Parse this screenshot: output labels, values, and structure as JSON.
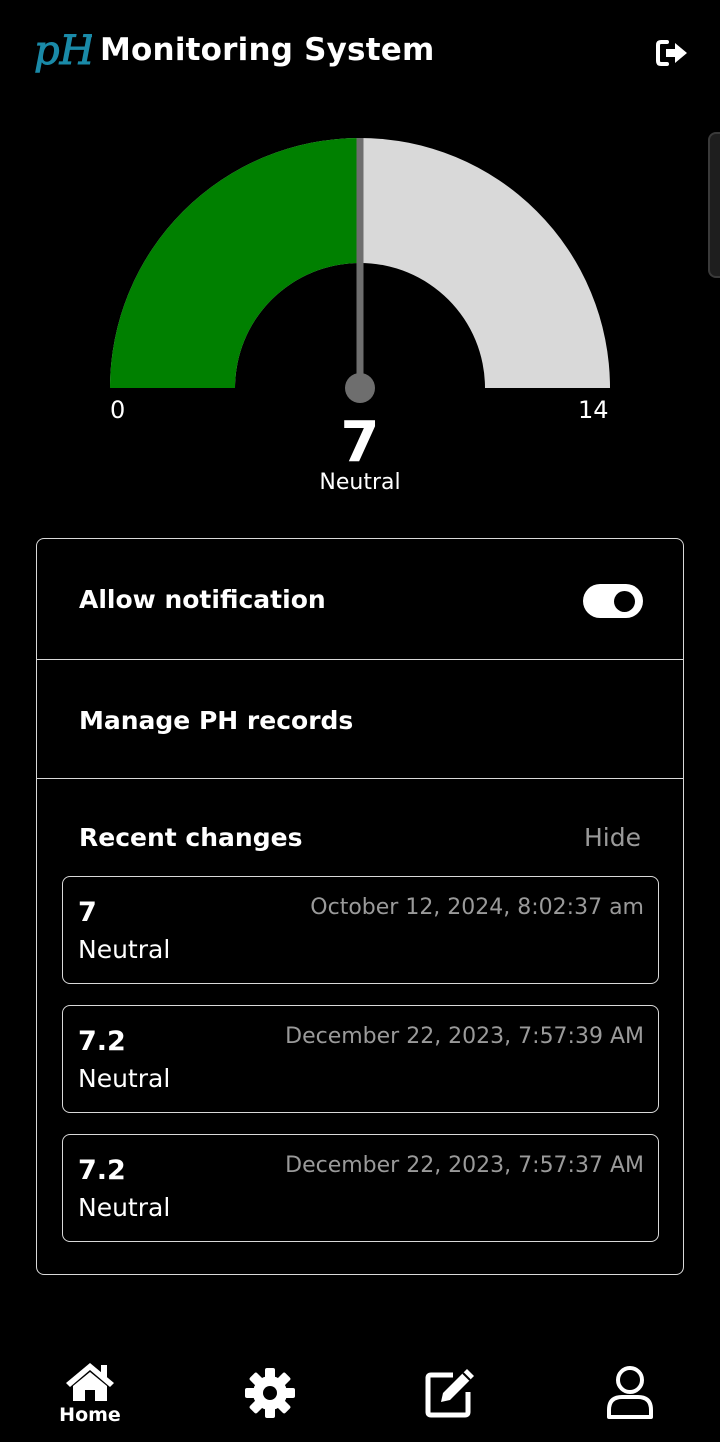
{
  "header": {
    "logo_text": "pH",
    "title": "Monitoring System",
    "logout_icon": "logout-icon"
  },
  "gauge": {
    "min_label": "0",
    "max_label": "14",
    "min": 0,
    "max": 14,
    "value": 7,
    "value_label": "7",
    "status": "Neutral",
    "fill_color": "#008000",
    "track_color": "#d9d9d9",
    "needle_color": "#6e6e6e"
  },
  "settings": {
    "notification_label": "Allow notification",
    "notification_enabled": true,
    "manage_label": "Manage PH records"
  },
  "recent": {
    "title": "Recent changes",
    "hide_label": "Hide",
    "records": [
      {
        "value": "7",
        "status": "Neutral",
        "time": "October 12, 2024, 8:02:37 am"
      },
      {
        "value": "7.2",
        "status": "Neutral",
        "time": "December 22, 2023, 7:57:39 AM"
      },
      {
        "value": "7.2",
        "status": "Neutral",
        "time": "December 22, 2023, 7:57:37 AM"
      }
    ]
  },
  "nav": {
    "items": [
      {
        "icon": "home-icon",
        "label": "Home",
        "active": true
      },
      {
        "icon": "gear-icon",
        "label": "",
        "active": false
      },
      {
        "icon": "edit-icon",
        "label": "",
        "active": false
      },
      {
        "icon": "user-icon",
        "label": "",
        "active": false
      }
    ]
  },
  "colors": {
    "accent": "#1a8aa8",
    "muted_text": "#9a9a9a",
    "border": "#d9d9d9"
  }
}
